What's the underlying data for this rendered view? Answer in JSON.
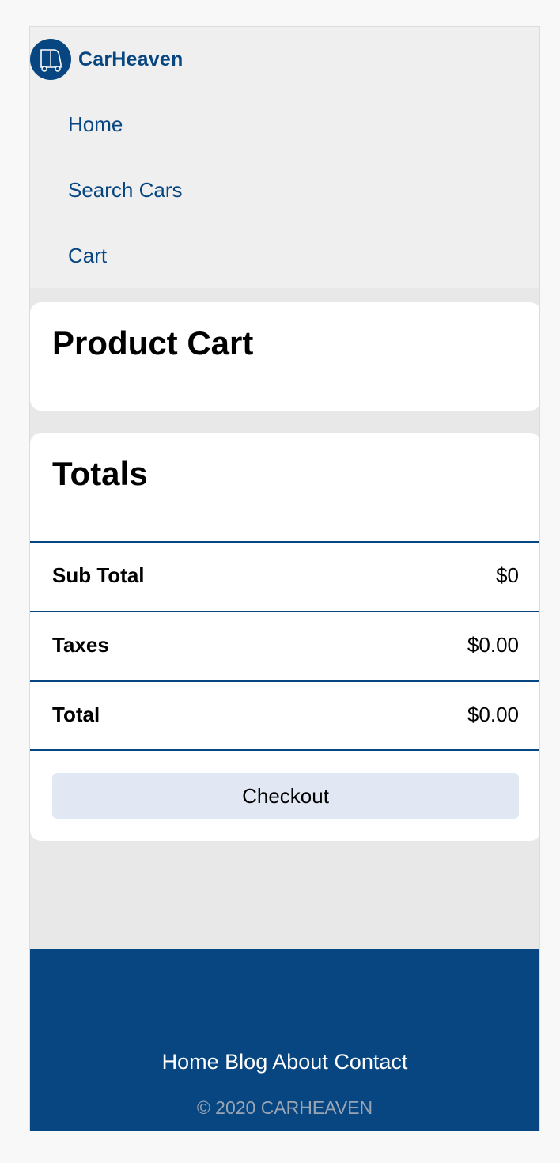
{
  "brand": {
    "name": "CarHeaven",
    "icon": "car-logo-icon",
    "color": "#074680"
  },
  "nav": {
    "items": [
      {
        "label": "Home"
      },
      {
        "label": "Search Cars"
      },
      {
        "label": "Cart"
      }
    ]
  },
  "cart": {
    "title": "Product Cart"
  },
  "totals": {
    "title": "Totals",
    "rows": [
      {
        "label": "Sub Total",
        "value": "$0"
      },
      {
        "label": "Taxes",
        "value": "$0.00"
      },
      {
        "label": "Total",
        "value": "$0.00"
      }
    ],
    "checkout_label": "Checkout"
  },
  "footer": {
    "links": [
      {
        "label": "Home"
      },
      {
        "label": "Blog"
      },
      {
        "label": "About"
      },
      {
        "label": "Contact"
      }
    ],
    "copyright": "© 2020 CARHEAVEN",
    "background": "#074680"
  }
}
